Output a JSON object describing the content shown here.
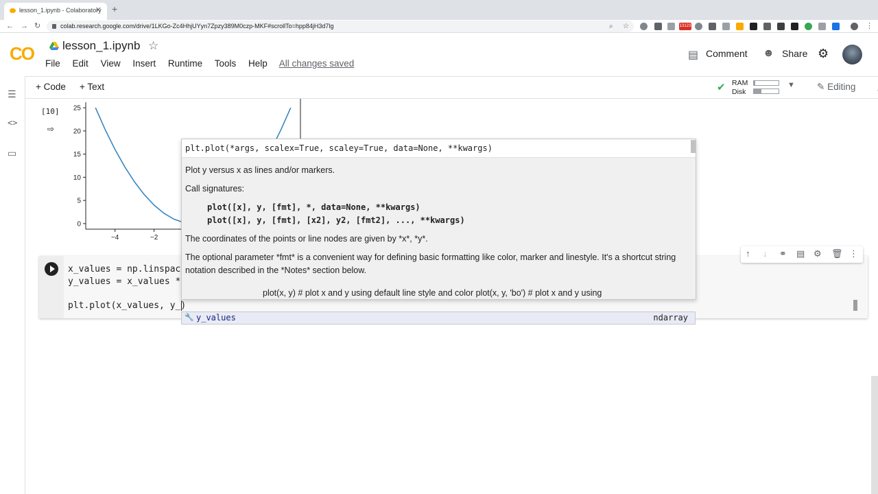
{
  "browser": {
    "tab_title": "lesson_1.ipynb - Colaboratory",
    "tab_close": "✕",
    "new_tab": "+",
    "url": "colab.research.google.com/drive/1LKGo-Zc4HhjUYyn7Zpzy389M0czp-MKF#scrollTo=hpp84jH3d7lg",
    "ext_badge": "13123"
  },
  "header": {
    "logo": "CO",
    "title": "lesson_1.ipynb",
    "menu": [
      "File",
      "Edit",
      "View",
      "Insert",
      "Runtime",
      "Tools",
      "Help"
    ],
    "save_status": "All changes saved",
    "comment": "Comment",
    "share": "Share"
  },
  "toolbar": {
    "add_code": "+ Code",
    "add_text": "+ Text",
    "ram_label": "RAM",
    "disk_label": "Disk",
    "ram_fraction": 0.05,
    "disk_fraction": 0.3,
    "mode": "Editing"
  },
  "output_cell": {
    "exec_count": "[10]"
  },
  "code_cell": {
    "lines": [
      "x_values = np.linspac",
      "y_values = x_values *",
      "plt.plot(x_values, y_)"
    ]
  },
  "docstring": {
    "signature": "plt.plot(*args, scalex=True, scaley=True, data=None, **kwargs)",
    "summary": "Plot y versus x as lines and/or markers.",
    "call_heading": "Call signatures:",
    "call_sig_1": "plot([x], y, [fmt], *, data=None, **kwargs)",
    "call_sig_2": "plot([x], y, [fmt], [x2], y2, [fmt2], ..., **kwargs)",
    "coords_text": "The coordinates of the points or line nodes are given by *x*, *y*.",
    "fmt_text_1": "The optional parameter *fmt* is a convenient way for defining basic formatting like color, marker and linestyle. It's a shortcut string",
    "fmt_text_2": "notation described in the *Notes* section below.",
    "example": "plot(x, y) # plot x and y using default line style and color plot(x, y, 'bo') # plot x and y using"
  },
  "autocomplete": {
    "label": "y_values",
    "type": "ndarray"
  },
  "colors": {
    "accent": "#f9ab00",
    "line": "#3b86c0",
    "check": "#34a853"
  },
  "chart_data": {
    "type": "line",
    "series": [
      {
        "x": [
          -5,
          -4.5,
          -4,
          -3.5,
          -3,
          -2.5,
          -2,
          -1.5,
          -1,
          -0.5,
          0,
          0.5,
          1,
          1.5,
          2,
          2.5,
          3,
          3.5,
          4,
          4.5,
          5
        ],
        "values": [
          25,
          20.25,
          16,
          12.25,
          9,
          6.25,
          4,
          2.25,
          1,
          0.25,
          0,
          0.25,
          1,
          2.25,
          4,
          6.25,
          9,
          12.25,
          16,
          20.25,
          25
        ]
      }
    ],
    "x_ticks": [
      -4,
      -2
    ],
    "y_ticks": [
      0,
      5,
      10,
      15,
      20,
      25
    ],
    "xlim": [
      -5.5,
      5.5
    ],
    "ylim": [
      -1.2,
      26.2
    ]
  }
}
